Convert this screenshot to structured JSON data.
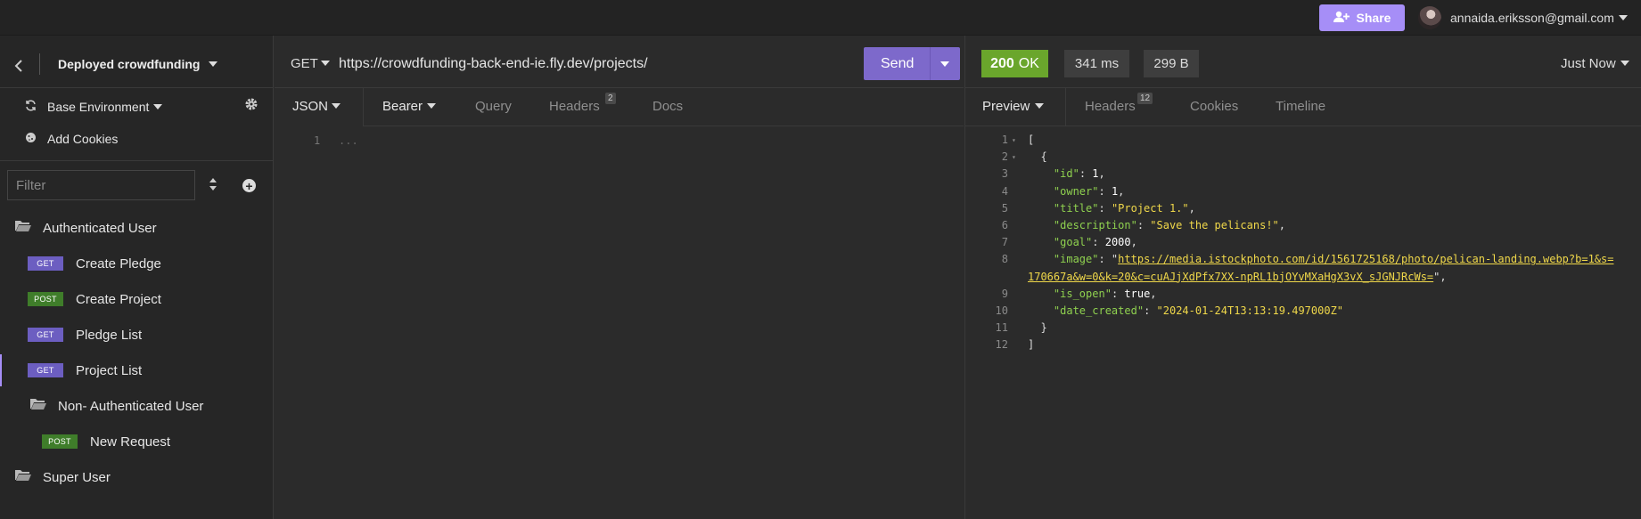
{
  "topbar": {
    "share_label": "Share",
    "user_email": "annaida.eriksson@gmail.com"
  },
  "sidebar": {
    "workspace_title": "Deployed crowdfunding",
    "environment_label": "Base Environment",
    "add_cookies_label": "Add Cookies",
    "filter_placeholder": "Filter",
    "tree": [
      {
        "type": "folder",
        "label": "Authenticated User"
      },
      {
        "type": "request",
        "method": "GET",
        "label": "Create Pledge"
      },
      {
        "type": "request",
        "method": "POST",
        "label": "Create Project"
      },
      {
        "type": "request",
        "method": "GET",
        "label": "Pledge List"
      },
      {
        "type": "request",
        "method": "GET",
        "label": "Project List",
        "active": true
      },
      {
        "type": "folder",
        "label": "Non- Authenticated User"
      },
      {
        "type": "request",
        "method": "POST",
        "label": "New Request"
      },
      {
        "type": "folder",
        "label": "Super User"
      }
    ]
  },
  "request": {
    "method": "GET",
    "url": "https://crowdfunding-back-end-ie.fly.dev/projects/",
    "send_label": "Send",
    "tabs": {
      "body": "JSON",
      "auth": "Bearer",
      "query": "Query",
      "headers": "Headers",
      "headers_count": "2",
      "docs": "Docs"
    },
    "body_line_number": "1",
    "body_placeholder": "..."
  },
  "response": {
    "status_code": "200",
    "status_text": "OK",
    "time": "341 ms",
    "size": "299 B",
    "time_ago": "Just Now",
    "tabs": {
      "preview": "Preview",
      "headers": "Headers",
      "headers_count": "12",
      "cookies": "Cookies",
      "timeline": "Timeline"
    },
    "json": {
      "id_key": "\"id\"",
      "id_val": "1",
      "owner_key": "\"owner\"",
      "owner_val": "1",
      "title_key": "\"title\"",
      "title_val": "\"Project 1.\"",
      "description_key": "\"description\"",
      "description_val": "\"Save the pelicans!\"",
      "goal_key": "\"goal\"",
      "goal_val": "2000",
      "image_key": "\"image\"",
      "image_val": "https://media.istockphoto.com/id/1561725168/photo/pelican-landing.webp?b=1&s=170667a&w=0&k=20&c=cuAJjXdPfx7XX-npRL1bjOYvMXaHgX3vX_sJGNJRcWs=",
      "is_open_key": "\"is_open\"",
      "is_open_val": "true",
      "date_key": "\"date_created\"",
      "date_val": "\"2024-01-24T13:13:19.497000Z\""
    }
  },
  "colors": {
    "accent": "#a68ef7",
    "send": "#7d69cb",
    "status_ok": "#6aa62c",
    "get_badge": "#6c5ec1",
    "post_badge": "#3f7d2a",
    "json_key": "#8fd14f",
    "json_string": "#f0d84a"
  },
  "icons": [
    "user-plus-icon",
    "back-chevron-icon",
    "refresh-icon",
    "gear-icon",
    "cookie-icon",
    "sort-icon",
    "add-circle-icon",
    "folder-open-icon"
  ]
}
